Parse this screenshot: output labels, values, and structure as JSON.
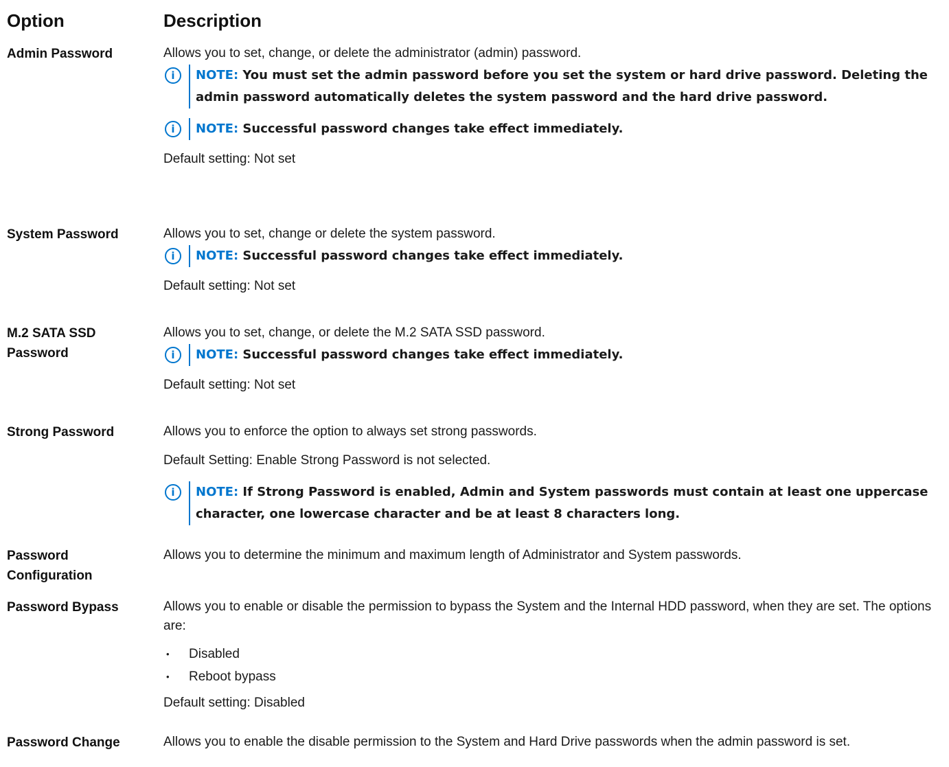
{
  "header": {
    "option": "Option",
    "description": "Description"
  },
  "note_label": "NOTE:",
  "info_icon": "info-circle-icon",
  "accent_color": "#0076ce",
  "rows": {
    "admin": {
      "option": "Admin Password",
      "desc": "Allows you to set, change, or delete the administrator (admin) password.",
      "note1": "You must set the admin password before you set the system or hard drive password. Deleting the admin password automatically deletes the system password and the hard drive password.",
      "note2": "Successful password changes take effect immediately.",
      "default": "Default setting: Not set"
    },
    "system": {
      "option": "System Password",
      "desc": "Allows you to set, change or delete the system password.",
      "note1": "Successful password changes take effect immediately.",
      "default": "Default setting: Not set"
    },
    "m2": {
      "option": "M.2 SATA SSD Password",
      "desc": "Allows you to set, change, or delete the M.2 SATA SSD password.",
      "note1": "Successful password changes take effect immediately.",
      "default": "Default setting: Not set"
    },
    "strong": {
      "option": "Strong Password",
      "desc": "Allows you to enforce the option to always set strong passwords.",
      "default": "Default Setting: Enable Strong Password is not selected.",
      "note1": "If Strong Password is enabled, Admin and System passwords must contain at least one uppercase character, one lowercase character and be at least 8 characters long."
    },
    "config": {
      "option": "Password Configuration",
      "desc": "Allows you to determine the minimum and maximum length of Administrator and System passwords."
    },
    "bypass": {
      "option": "Password Bypass",
      "desc": "Allows you to enable or disable the permission to bypass the System and the Internal HDD password, when they are set. The options are:",
      "items": [
        "Disabled",
        "Reboot bypass"
      ],
      "default": "Default setting: Disabled"
    },
    "change": {
      "option": "Password Change",
      "desc": "Allows you to enable the disable permission to the System and Hard Drive passwords when the admin password is set."
    }
  }
}
